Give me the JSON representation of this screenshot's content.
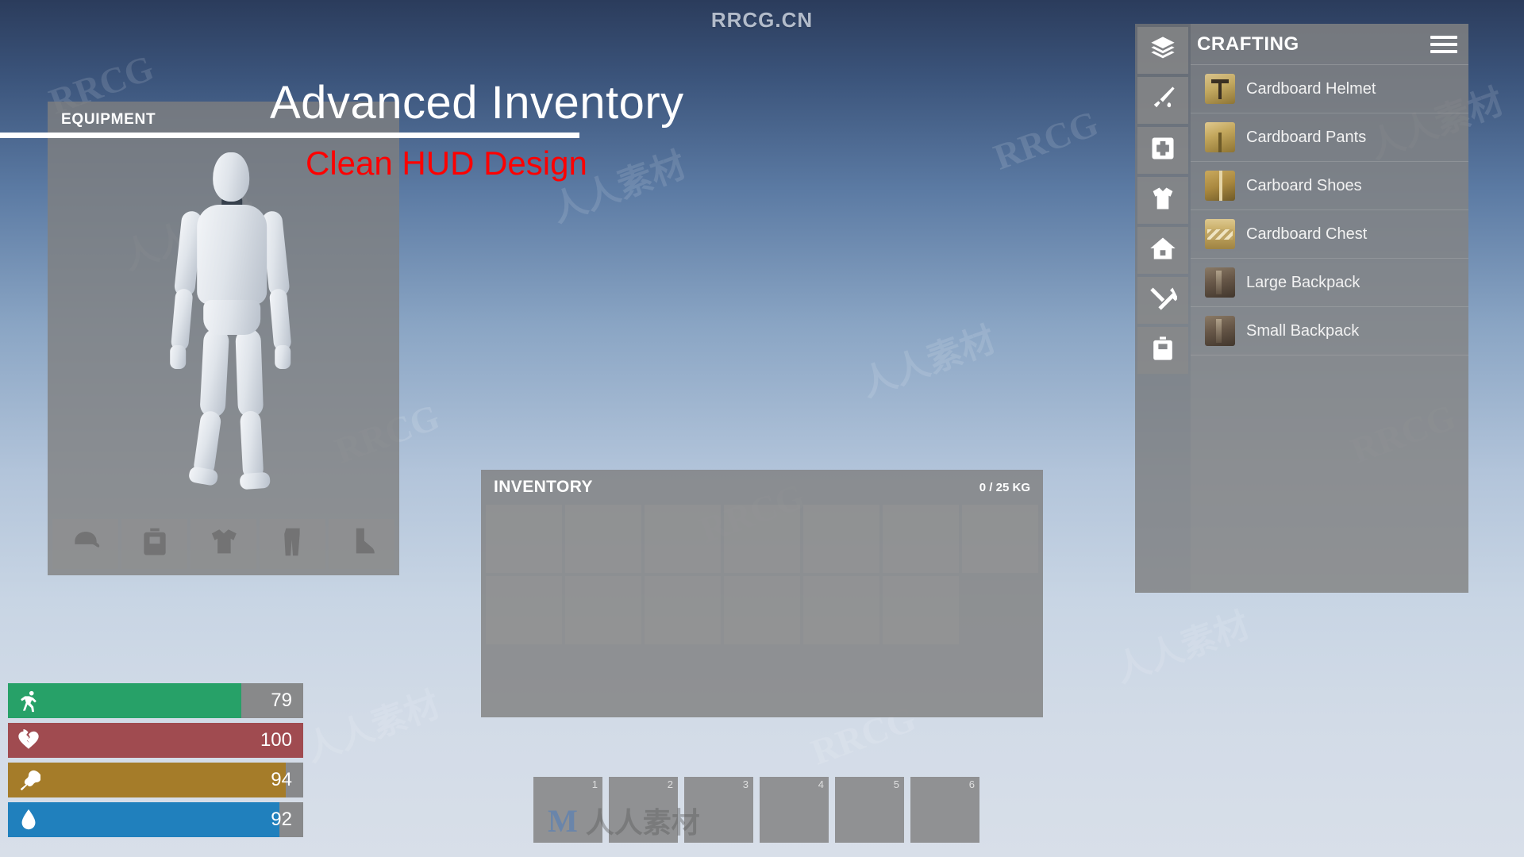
{
  "watermarks": {
    "top": "RRCG.CN",
    "tile_latin": "RRCG",
    "tile_cjk": "人人素材",
    "center_glyph": "M",
    "center_text": "人人素材"
  },
  "title": {
    "main": "Advanced Inventory",
    "sub": "Clean HUD Design",
    "sub_color": "#fe0000"
  },
  "equipment": {
    "header": "EQUIPMENT",
    "slots": [
      {
        "name": "head-slot",
        "icon": "cap-icon"
      },
      {
        "name": "backpack-slot",
        "icon": "backpack-icon"
      },
      {
        "name": "chest-slot",
        "icon": "shirt-icon"
      },
      {
        "name": "legs-slot",
        "icon": "pants-icon"
      },
      {
        "name": "feet-slot",
        "icon": "boot-icon"
      }
    ]
  },
  "inventory": {
    "title": "INVENTORY",
    "weight": "0 / 25 KG",
    "slot_count": 13,
    "columns": 7
  },
  "crafting": {
    "title": "CRAFTING",
    "menu_icon": "hamburger-menu-icon",
    "categories": [
      {
        "name": "category-all",
        "icon": "layers-icon"
      },
      {
        "name": "category-weapons",
        "icon": "knife-icon"
      },
      {
        "name": "category-medical",
        "icon": "medkit-cross-icon"
      },
      {
        "name": "category-clothing",
        "icon": "shirt-icon"
      },
      {
        "name": "category-building",
        "icon": "house-icon"
      },
      {
        "name": "category-tools",
        "icon": "tools-icon"
      },
      {
        "name": "category-storage",
        "icon": "backpack-icon"
      }
    ],
    "items": [
      {
        "label": "Cardboard Helmet",
        "icon_class": "ic-helmet",
        "icon_name": "cardboard-helmet-icon"
      },
      {
        "label": "Cardboard Pants",
        "icon_class": "ic-pants",
        "icon_name": "cardboard-pants-icon"
      },
      {
        "label": "Carboard Shoes",
        "icon_class": "ic-shoes",
        "icon_name": "cardboard-shoes-icon"
      },
      {
        "label": "Cardboard Chest",
        "icon_class": "ic-chest",
        "icon_name": "cardboard-chest-icon"
      },
      {
        "label": "Large Backpack",
        "icon_class": "ic-backpack",
        "icon_name": "large-backpack-icon"
      },
      {
        "label": "Small Backpack",
        "icon_class": "ic-backpack",
        "icon_name": "small-backpack-icon"
      }
    ]
  },
  "stats": [
    {
      "name": "stamina",
      "icon": "running-man-icon",
      "value": "79",
      "percent": 79,
      "color": "#27a168"
    },
    {
      "name": "health",
      "icon": "broken-heart-icon",
      "value": "100",
      "percent": 100,
      "color": "#a04b50"
    },
    {
      "name": "hunger",
      "icon": "drumstick-icon",
      "value": "94",
      "percent": 94,
      "color": "#a57c29"
    },
    {
      "name": "thirst",
      "icon": "water-drop-icon",
      "value": "92",
      "percent": 92,
      "color": "#2080bd"
    }
  ],
  "hotbar": {
    "slots": [
      "1",
      "2",
      "3",
      "4",
      "5",
      "6"
    ]
  }
}
